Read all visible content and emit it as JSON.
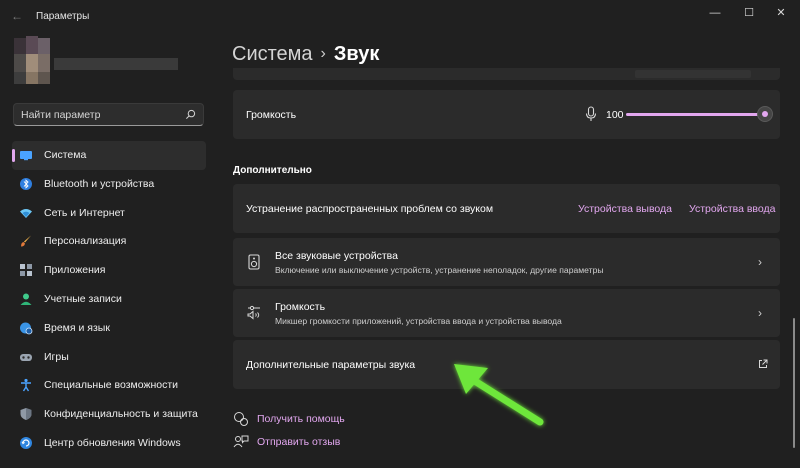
{
  "window": {
    "title": "Параметры",
    "controls": [
      "minimize",
      "maximize",
      "close"
    ]
  },
  "search": {
    "placeholder": "Найти параметр",
    "icon": "search-icon"
  },
  "sidebar": {
    "items": [
      {
        "label": "Система",
        "icon": "monitor-icon",
        "active": true
      },
      {
        "label": "Bluetooth и устройства",
        "icon": "bluetooth-icon"
      },
      {
        "label": "Сеть и Интернет",
        "icon": "wifi-icon"
      },
      {
        "label": "Персонализация",
        "icon": "brush-icon"
      },
      {
        "label": "Приложения",
        "icon": "apps-icon"
      },
      {
        "label": "Учетные записи",
        "icon": "account-icon"
      },
      {
        "label": "Время и язык",
        "icon": "globe-clock-icon"
      },
      {
        "label": "Игры",
        "icon": "gamepad-icon"
      },
      {
        "label": "Специальные возможности",
        "icon": "accessibility-icon"
      },
      {
        "label": "Конфиденциальность и защита",
        "icon": "shield-icon"
      },
      {
        "label": "Центр обновления Windows",
        "icon": "update-icon"
      }
    ]
  },
  "breadcrumb": {
    "parent": "Система",
    "separator": "›",
    "current": "Звук"
  },
  "volume": {
    "label": "Громкость",
    "value": "100",
    "level_percent": 100
  },
  "section": {
    "title": "Дополнительно"
  },
  "troubleshoot": {
    "label": "Устранение распространенных проблем со звуком",
    "output_link": "Устройства вывода",
    "input_link": "Устройства ввода"
  },
  "all_devices": {
    "title": "Все звуковые устройства",
    "subtitle": "Включение или выключение устройств, устранение неполадок, другие параметры"
  },
  "mixer": {
    "title": "Громкость",
    "subtitle": "Микшер громкости приложений, устройства ввода и устройства вывода"
  },
  "advanced": {
    "title": "Дополнительные параметры звука"
  },
  "footer": {
    "help": "Получить помощь",
    "feedback": "Отправить отзыв"
  },
  "colors": {
    "accent": "#e2a7ef",
    "background": "#202020",
    "card": "#2b2b2b",
    "arrow": "#6ee63a"
  }
}
